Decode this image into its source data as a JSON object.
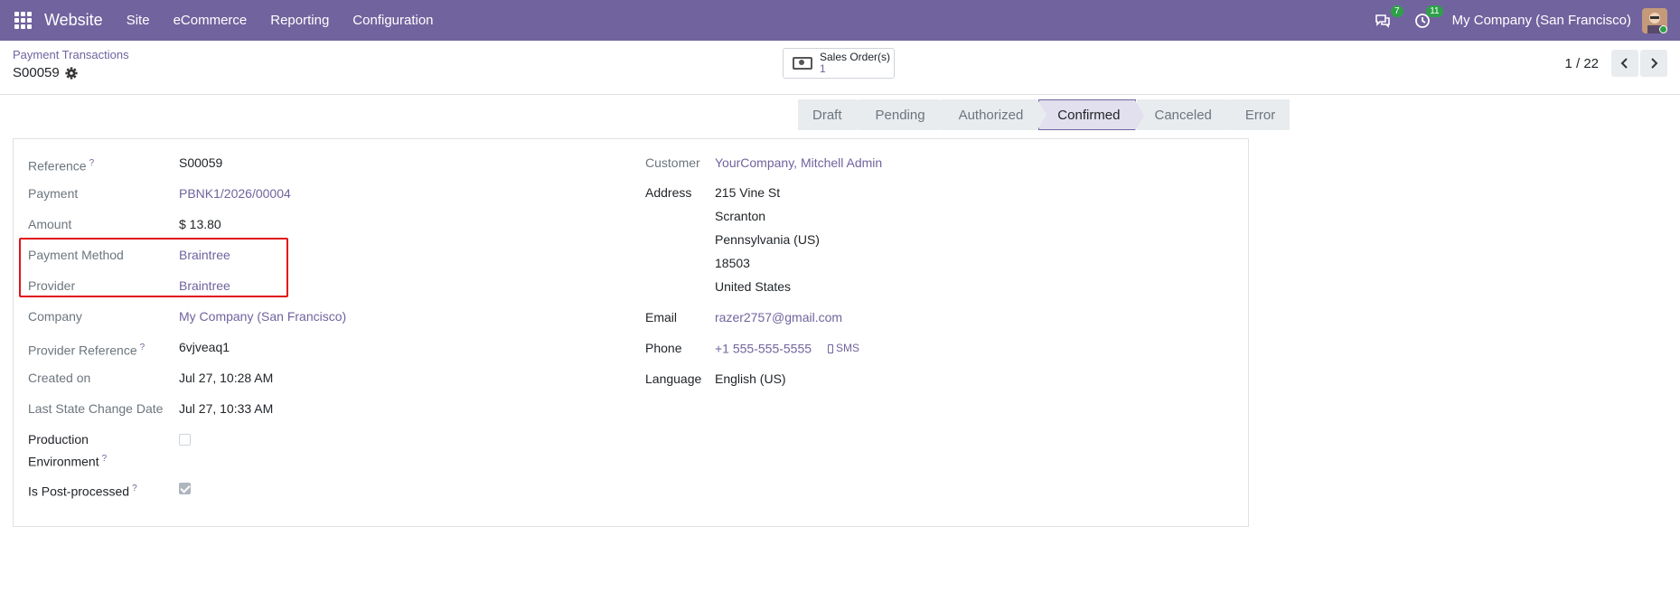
{
  "navbar": {
    "app": "Website",
    "menu": [
      "Site",
      "eCommerce",
      "Reporting",
      "Configuration"
    ],
    "messages_badge": "7",
    "activity_badge": "11",
    "company": "My Company (San Francisco)"
  },
  "control": {
    "breadcrumb": "Payment Transactions",
    "record": "S00059",
    "smart_button_label": "Sales Order(s)",
    "smart_button_count": "1",
    "pager": "1 / 22"
  },
  "stages": [
    "Draft",
    "Pending",
    "Authorized",
    "Confirmed",
    "Canceled",
    "Error"
  ],
  "active_stage": "Confirmed",
  "left_fields": {
    "reference_label": "Reference",
    "reference": "S00059",
    "payment_label": "Payment",
    "payment": "PBNK1/2026/00004",
    "amount_label": "Amount",
    "amount": "$ 13.80",
    "method_label": "Payment Method",
    "method": "Braintree",
    "provider_label": "Provider",
    "provider": "Braintree",
    "company_label": "Company",
    "company": "My Company (San Francisco)",
    "provider_ref_label": "Provider Reference",
    "provider_ref": "6vjveaq1",
    "created_label": "Created on",
    "created": "Jul 27, 10:28 AM",
    "last_change_label": "Last State Change Date",
    "last_change": "Jul 27, 10:33 AM",
    "production_label_1": "Production",
    "production_label_2": "Environment",
    "post_processed_label": "Is Post-processed"
  },
  "right_fields": {
    "customer_label": "Customer",
    "customer": "YourCompany, Mitchell Admin",
    "address_label": "Address",
    "address": [
      "215 Vine St",
      "Scranton",
      "Pennsylvania (US)",
      "18503",
      "United States"
    ],
    "email_label": "Email",
    "email": "razer2757@gmail.com",
    "phone_label": "Phone",
    "phone": "+1 555-555-5555",
    "sms": "SMS",
    "language_label": "Language",
    "language": "English (US)"
  },
  "help_mark": "?"
}
